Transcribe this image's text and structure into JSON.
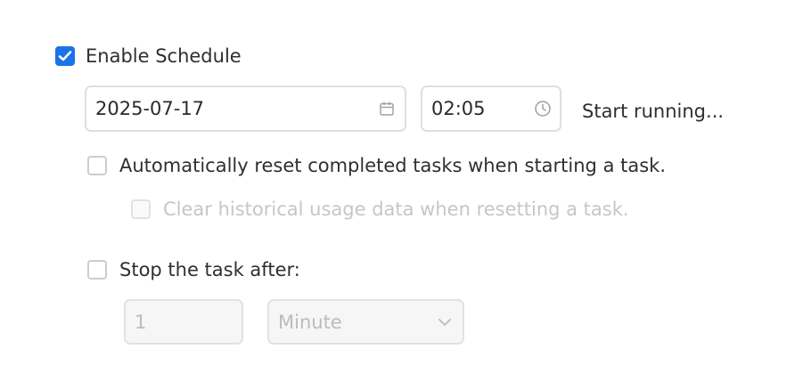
{
  "schedule": {
    "enable_label": "Enable Schedule",
    "enabled": true,
    "date": "2025-07-17",
    "time": "02:05",
    "start_label": "Start running..."
  },
  "reset_option": {
    "label": "Automatically reset completed tasks when starting a task.",
    "checked": false
  },
  "clear_history_option": {
    "label": "Clear historical usage data when resetting a task.",
    "checked": false,
    "disabled": true
  },
  "stop_option": {
    "label": "Stop the task after:",
    "checked": false,
    "amount_value": "1",
    "unit_selected": "Minute"
  },
  "colors": {
    "accent": "#1a73e8",
    "border": "#dcdfe3",
    "disabled_text": "#c4c7ca"
  },
  "icons": {
    "date": "calendar-icon",
    "time": "clock-icon",
    "select": "chevron-down-icon",
    "check": "checkmark-icon"
  }
}
